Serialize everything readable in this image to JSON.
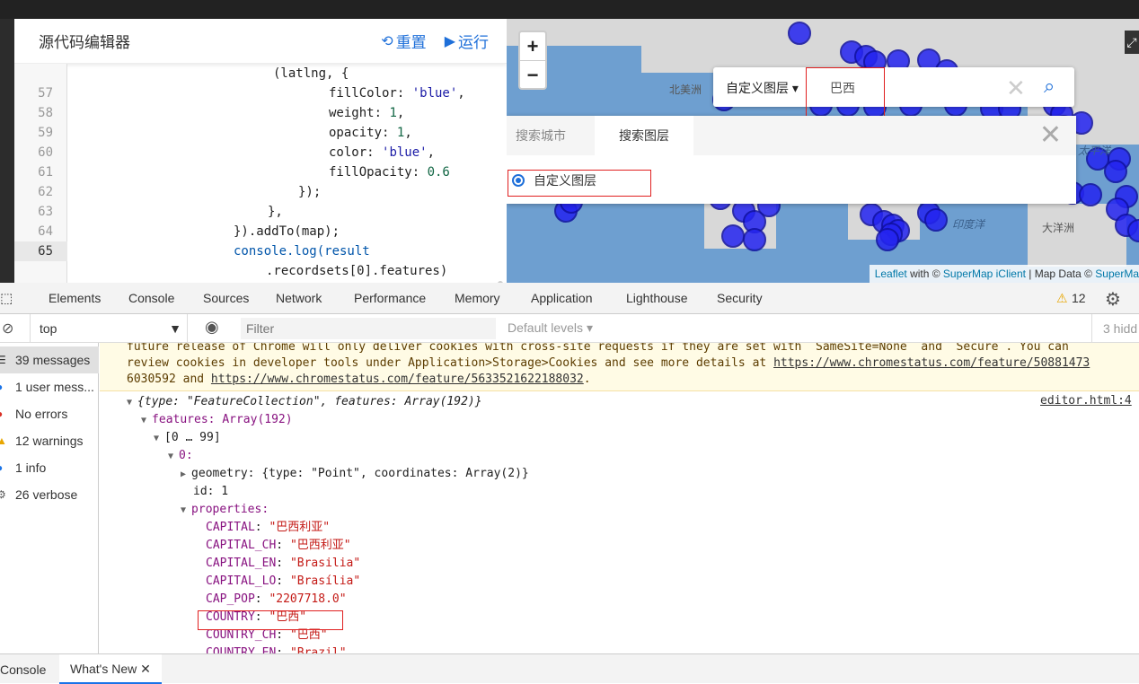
{
  "editor": {
    "title": "源代码编辑器",
    "reset_label": "重置",
    "run_label": "运行",
    "lines": [
      {
        "no": "",
        "text": "(latlng, {"
      },
      {
        "no": "57",
        "key": "fillColor",
        "sep": ": ",
        "val": "'blue'",
        "tail": ","
      },
      {
        "no": "58",
        "key": "weight",
        "sep": ": ",
        "val": "1",
        "tail": ","
      },
      {
        "no": "59",
        "key": "opacity",
        "sep": ": ",
        "val": "1",
        "tail": ","
      },
      {
        "no": "60",
        "key": "color",
        "sep": ": ",
        "val": "'blue'",
        "tail": ","
      },
      {
        "no": "61",
        "key": "fillOpacity",
        "sep": ": ",
        "val": "0.6",
        "tail": ""
      },
      {
        "no": "62",
        "text": "});"
      },
      {
        "no": "63",
        "text": "},"
      },
      {
        "no": "64",
        "text": "}).addTo(map);"
      },
      {
        "no": "65",
        "text": "console.log(result"
      },
      {
        "no": "",
        "text": ".recordsets[0].features)"
      }
    ]
  },
  "map": {
    "zoom_in": "+",
    "zoom_out": "−",
    "layer_select": "自定义图层",
    "search_value": "巴西",
    "tabs": [
      "搜索城市",
      "搜索图层"
    ],
    "radio_label": "自定义图层",
    "labels": {
      "north_america": "北美洲",
      "pacific": "太平洋",
      "indian_ocean": "印度洋",
      "oceania": "大洋洲"
    },
    "attribution": {
      "leaflet": "Leaflet",
      "with": " with © ",
      "supermap": "SuperMap iClient",
      "sep": " | Map Data © ",
      "supermap2": "SuperMa"
    }
  },
  "devtools": {
    "tabs": [
      "Elements",
      "Console",
      "Sources",
      "Network",
      "Performance",
      "Memory",
      "Application",
      "Lighthouse",
      "Security"
    ],
    "warnings_count": "12",
    "context": "top",
    "filter_placeholder": "Filter",
    "levels": "Default levels",
    "hidden": "3 hidd",
    "sidebar": [
      {
        "label": "39 messages",
        "icon": "list-icon"
      },
      {
        "label": "1 user mess...",
        "icon": "user-icon"
      },
      {
        "label": "No errors",
        "icon": "error-icon"
      },
      {
        "label": "12 warnings",
        "icon": "warning-icon"
      },
      {
        "label": "1 info",
        "icon": "info-icon"
      },
      {
        "label": "26 verbose",
        "icon": "verbose-icon"
      }
    ],
    "warning_lines": [
      "future release of Chrome will only deliver cookies with cross-site requests if they are set with `SameSite=None` and `Secure`. You can",
      "review cookies in developer tools under Application>Storage>Cookies and see more details at ",
      "6030592 and "
    ],
    "warning_links": [
      "https://www.chromestatus.com/feature/50881473",
      "https://www.chromestatus.com/feature/5633521622188032"
    ],
    "source_link": "editor.html:4",
    "log": {
      "root": "{type: \"FeatureCollection\", features: Array(192)}",
      "features": "features: Array(192)",
      "range": "[0 … 99]",
      "idx": "0:",
      "geometry": "geometry: {type: \"Point\", coordinates: Array(2)}",
      "id": "id: 1",
      "properties": "properties:",
      "props": [
        {
          "k": "CAPITAL",
          "v": "\"巴西利亚\""
        },
        {
          "k": "CAPITAL_CH",
          "v": "\"巴西利亚\""
        },
        {
          "k": "CAPITAL_EN",
          "v": "\"Brasilia\""
        },
        {
          "k": "CAPITAL_LO",
          "v": "\"Brasília\""
        },
        {
          "k": "CAP_POP",
          "v": "\"2207718.0\""
        },
        {
          "k": "COUNTRY",
          "v": "\"巴西\""
        },
        {
          "k": "COUNTRY_CH",
          "v": "\"巴西\""
        },
        {
          "k": "COUNTRY_EN",
          "v": "\"Brazil\""
        }
      ]
    },
    "bottom_tabs": [
      "Console",
      "What's New"
    ]
  }
}
